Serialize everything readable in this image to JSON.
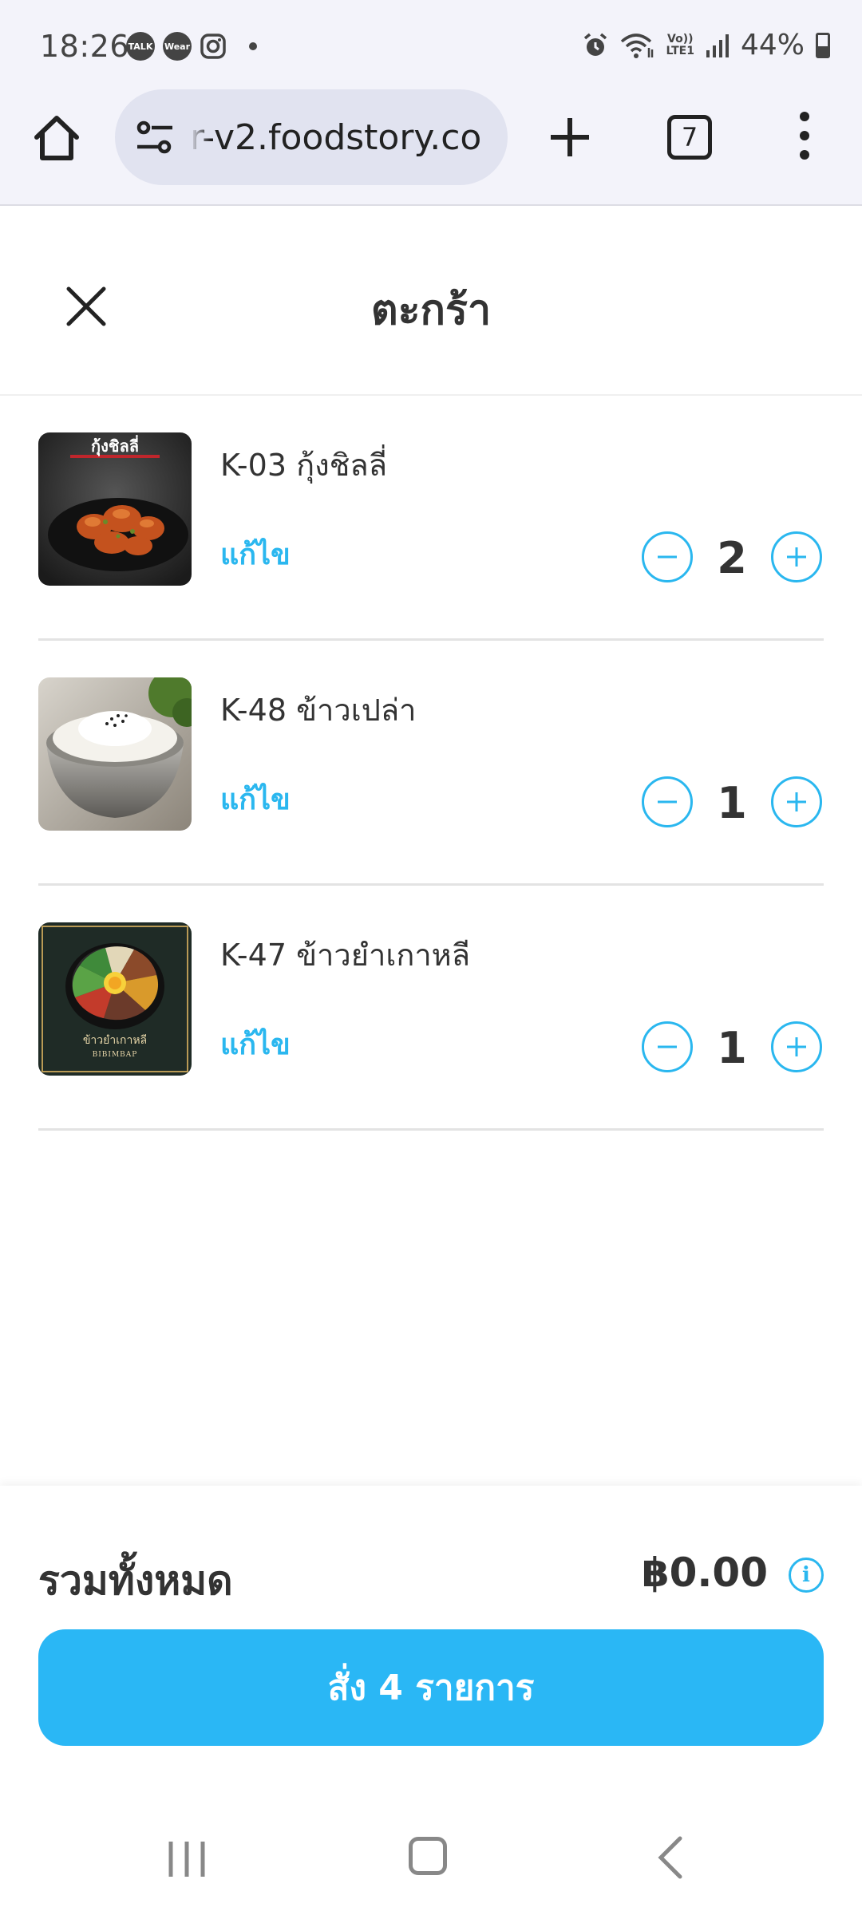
{
  "status_bar": {
    "time": "18:26",
    "notifications": [
      "TALK",
      "Wear"
    ],
    "battery": "44%",
    "network_label": "Vo))\nLTE1"
  },
  "browser": {
    "url": "r-v2.foodstory.co",
    "tab_count": "7"
  },
  "page": {
    "title": "ตะกร้า"
  },
  "cart": {
    "items": [
      {
        "name": "K-03 กุ้งชิลลี่",
        "edit_label": "แก้ไข",
        "quantity": "2",
        "image": "chili-shrimp",
        "image_caption": "กุ้งชิลลี่"
      },
      {
        "name": "K-48 ข้าวเปล่า",
        "edit_label": "แก้ไข",
        "quantity": "1",
        "image": "plain-rice"
      },
      {
        "name": "K-47 ข้าวยำเกาหลี",
        "edit_label": "แก้ไข",
        "quantity": "1",
        "image": "bibimbap",
        "image_caption": "ข้าวยำเกาหลี",
        "image_caption_en": "BIBIMBAP"
      }
    ]
  },
  "footer": {
    "total_label": "รวมทั้งหมด",
    "total_value": "฿0.00",
    "order_button_label": "สั่ง 4 รายการ"
  },
  "colors": {
    "accent": "#2ab7ef",
    "button": "#2ab7f5",
    "text": "#333333"
  }
}
